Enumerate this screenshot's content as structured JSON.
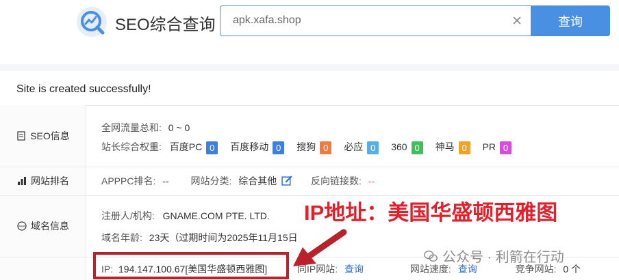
{
  "header": {
    "logo_text": "SEO综合查询",
    "search_value": "apk.xafa.shop",
    "search_button": "查询"
  },
  "status_message": "Site is created successfully!",
  "seo_info": {
    "label": "SEO信息",
    "traffic_label": "全网流量总和:",
    "traffic_value": "0 ~ 0",
    "weight_label": "站长综合权重:",
    "metrics": [
      {
        "name": "百度PC",
        "value": "0",
        "color": "#3d7fe0"
      },
      {
        "name": "百度移动",
        "value": "0",
        "color": "#3d7fe0"
      },
      {
        "name": "搜狗",
        "value": "0",
        "color": "#f07b3f"
      },
      {
        "name": "必应",
        "value": "0",
        "color": "#5aaee8"
      },
      {
        "name": "360",
        "value": "0",
        "color": "#3fbf5a"
      },
      {
        "name": "神马",
        "value": "0",
        "color": "#f2a12a"
      },
      {
        "name": "PR",
        "value": "0",
        "color": "#d64ee0"
      }
    ]
  },
  "site_rank": {
    "label": "网站排名",
    "apppc_label": "APPPC排名:",
    "apppc_value": "--",
    "category_label": "网站分类:",
    "category_value": "综合其他",
    "backlinks_label": "反向链接数:",
    "backlinks_value": "--"
  },
  "domain_info": {
    "label": "域名信息",
    "registrant_label": "注册人/机构:",
    "registrant_value": "GNAME.COM PTE. LTD.",
    "age_label": "域名年龄:",
    "age_value": "23天（过期时间为2025年11月15日",
    "ip_label": "IP:",
    "ip_value": "194.147.100.67[美国华盛顿西雅图]",
    "same_ip_label": "同IP网站:",
    "same_ip_value": "查询",
    "speed_label": "网站速度:",
    "speed_value": "查询",
    "competitor_label": "竞争网站:",
    "competitor_value": "0 个"
  },
  "annotation": "IP地址：美国华盛顿西雅图",
  "watermark": "公众号 · 利箭在行动"
}
